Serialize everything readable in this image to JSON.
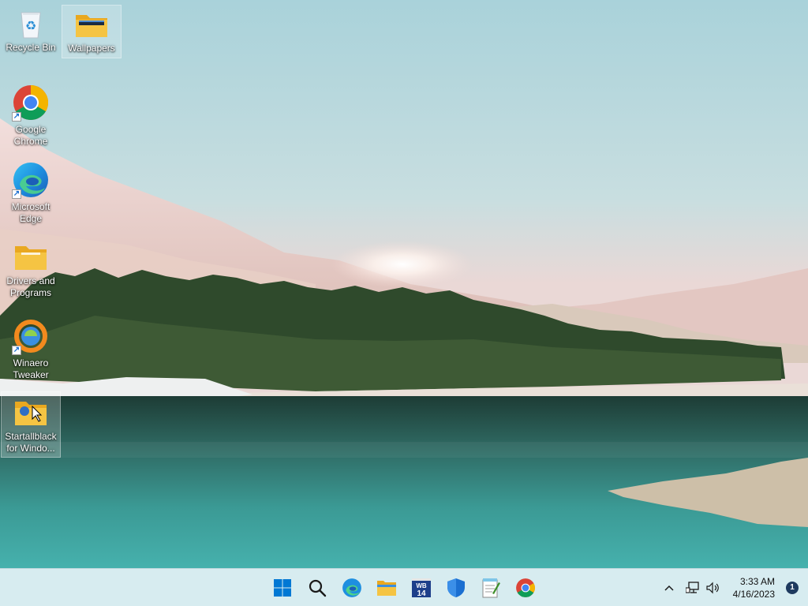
{
  "desktop": {
    "icons": [
      {
        "id": "recycle-bin",
        "label": "Recycle Bin",
        "icon": "recycle-bin-icon",
        "shortcut": false
      },
      {
        "id": "wallpapers",
        "label": "Wallpapers",
        "icon": "folder-icon",
        "shortcut": false,
        "selected": true
      },
      {
        "id": "google-chrome",
        "label": "Google Chrome",
        "icon": "chrome-icon",
        "shortcut": true
      },
      {
        "id": "microsoft-edge",
        "label": "Microsoft Edge",
        "icon": "edge-icon",
        "shortcut": true
      },
      {
        "id": "drivers-and-programs",
        "label": "Drivers and Programs",
        "icon": "folder-icon",
        "shortcut": false
      },
      {
        "id": "winaero-tweaker",
        "label": "Winaero Tweaker",
        "icon": "winaero-tweaker-icon",
        "shortcut": true
      },
      {
        "id": "startallblack",
        "label": "Startallblack for Windo...",
        "icon": "folder-icon",
        "shortcut": false,
        "selected": true
      }
    ]
  },
  "taskbar": {
    "pinned": [
      {
        "name": "start-button",
        "icon": "windows-logo-icon"
      },
      {
        "name": "search-button",
        "icon": "search-icon"
      },
      {
        "name": "edge-taskbar-button",
        "icon": "edge-icon"
      },
      {
        "name": "file-explorer-button",
        "icon": "folder-icon"
      },
      {
        "name": "winbuilder-button",
        "icon": "wb14-icon",
        "text": "WB 14"
      },
      {
        "name": "windows-security-button",
        "icon": "shield-icon"
      },
      {
        "name": "notepad-button",
        "icon": "notepad-icon"
      },
      {
        "name": "chrome-taskbar-button",
        "icon": "chrome-icon"
      }
    ],
    "tray": {
      "chevron": "^",
      "time": "3:33 AM",
      "date": "4/16/2023",
      "notification_count": "1"
    }
  },
  "colors": {
    "taskbar_bg": "#d7ecf0",
    "windows_blue": "#0078d4",
    "folder_yellow": "#f5c443"
  }
}
